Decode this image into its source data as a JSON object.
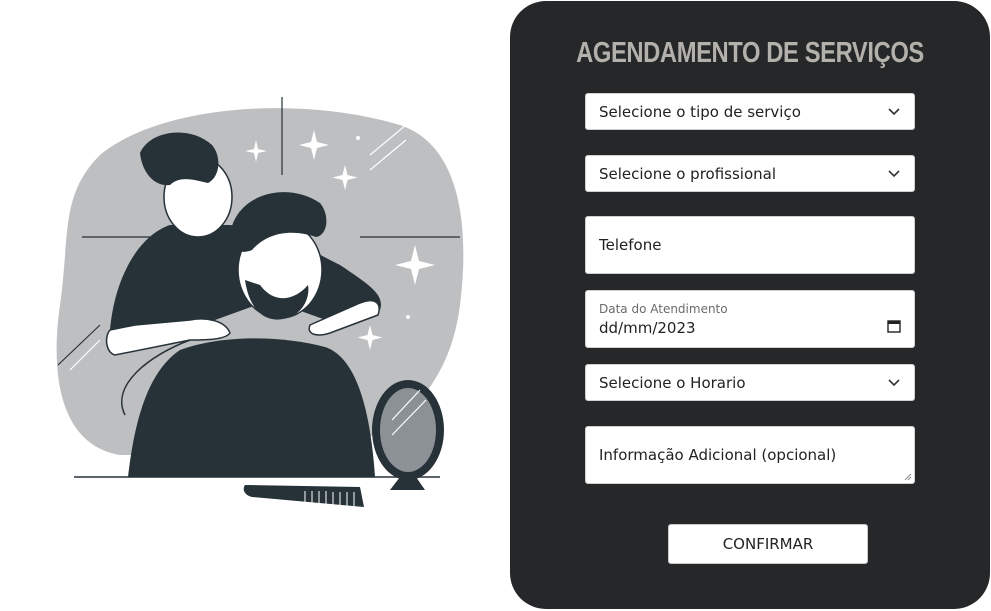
{
  "form": {
    "title": "AGENDAMENTO DE SERVIÇOS",
    "service_select": {
      "selected": "Selecione o tipo de serviço"
    },
    "professional_select": {
      "selected": "Selecione o profissional"
    },
    "phone": {
      "placeholder": "Telefone"
    },
    "date": {
      "label": "Data do Atendimento",
      "value": "dd/mm/2023"
    },
    "time_select": {
      "selected": "Selecione o Horario"
    },
    "notes": {
      "placeholder": "Informação Adicional (opcional)"
    },
    "confirm_label": "CONFIRMAR"
  },
  "colors": {
    "panel_bg": "#262729",
    "title": "#b4b0ac",
    "illustration_blob": "#bdbfc1",
    "illustration_dark": "#263238"
  },
  "icons": {
    "select_arrow": "chevron-down-icon",
    "date_picker": "calendar-icon",
    "hero": "barber-illustration"
  }
}
